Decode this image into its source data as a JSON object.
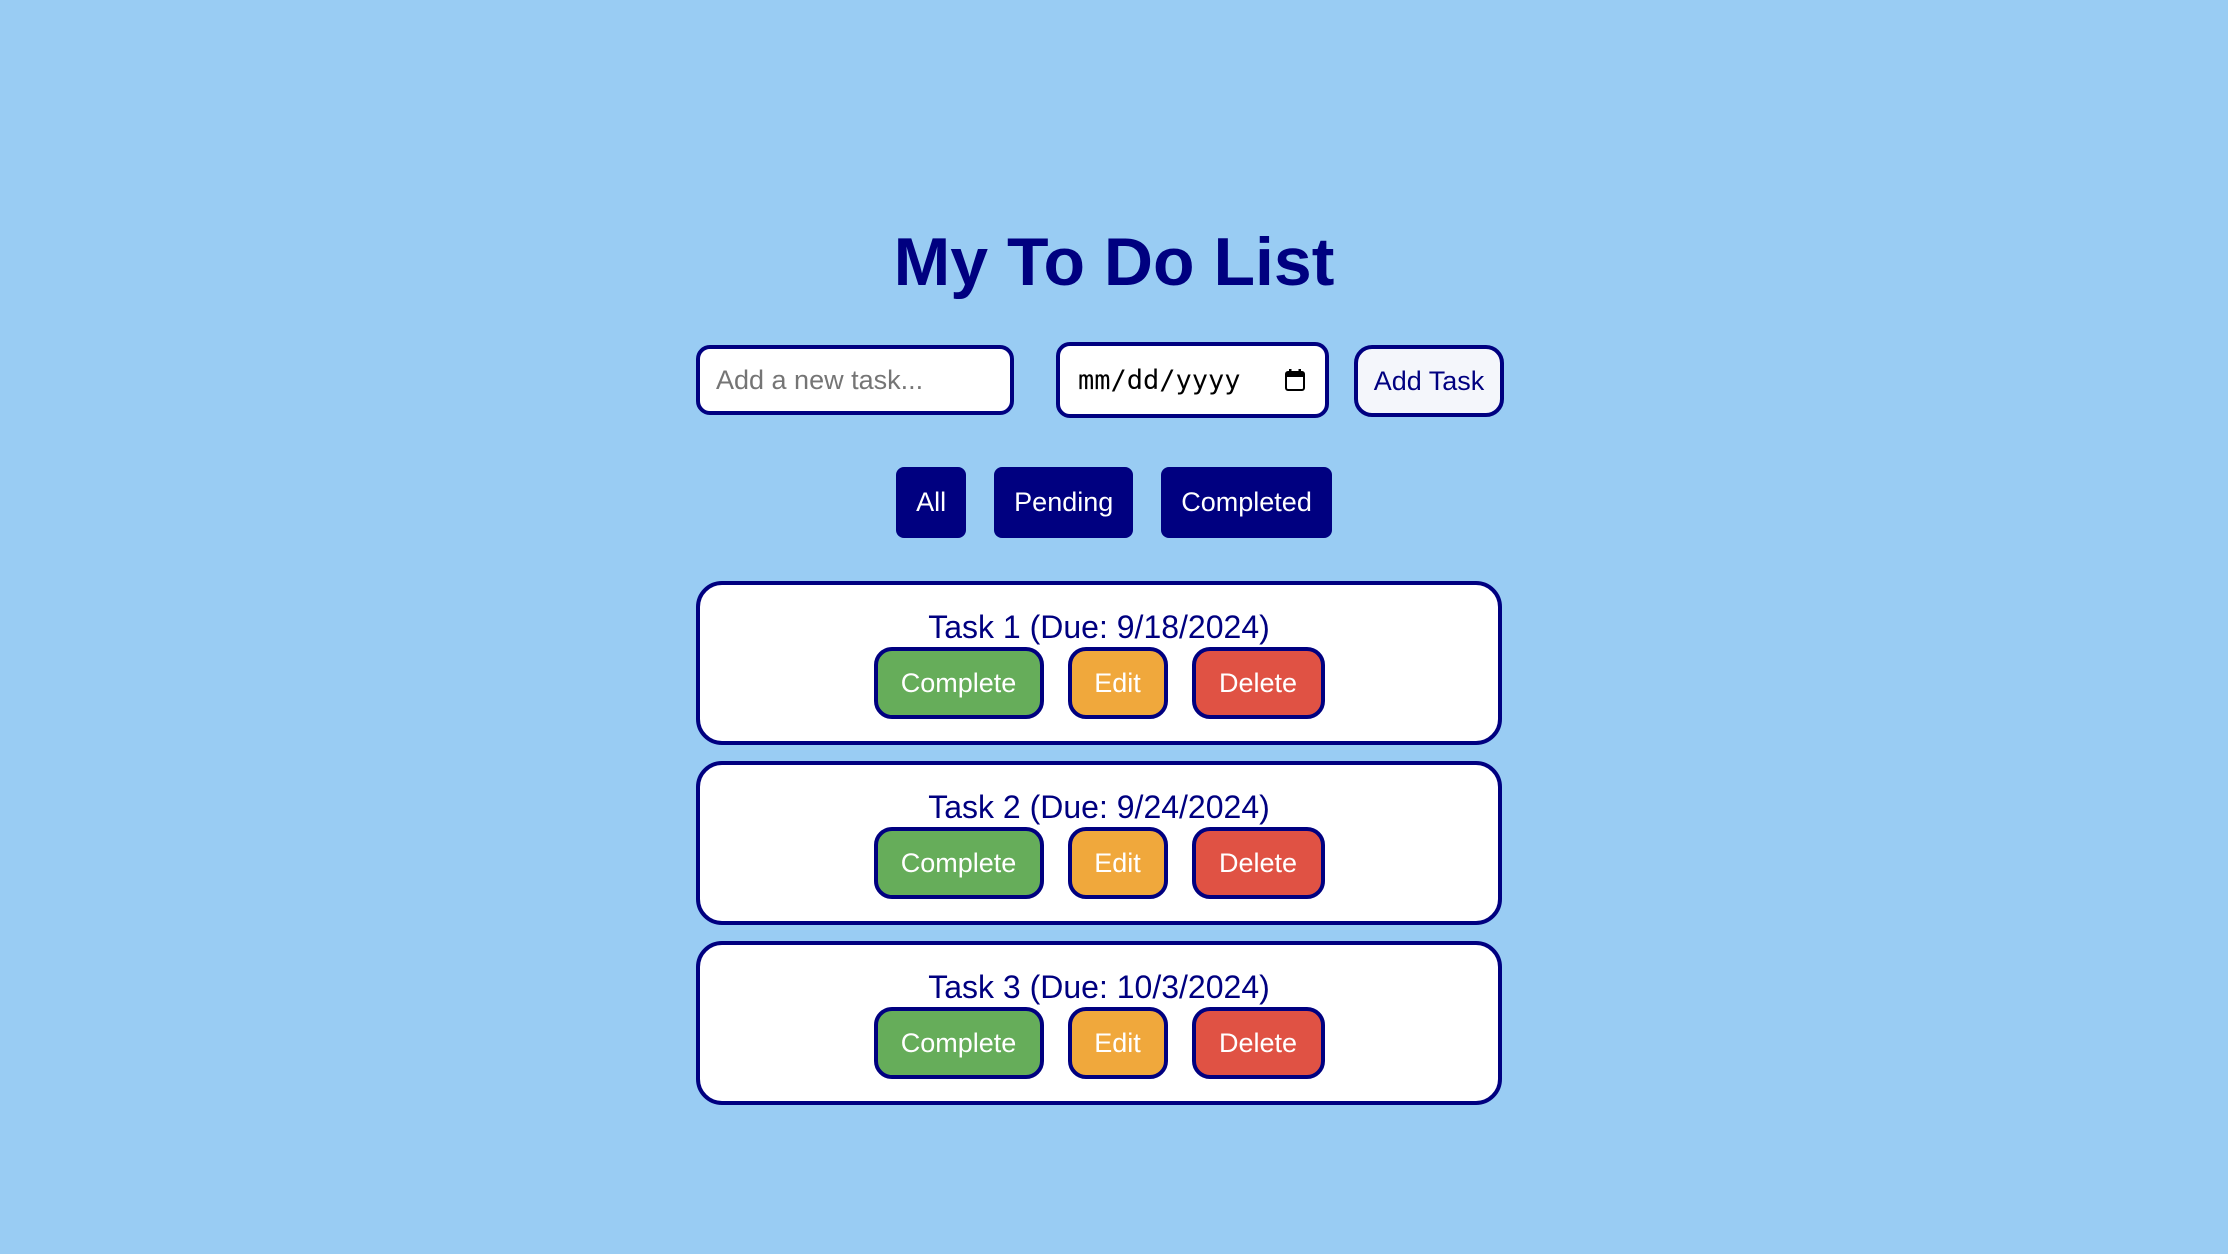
{
  "app": {
    "title": "My To Do List"
  },
  "add_form": {
    "task_placeholder": "Add a new task...",
    "task_value": "",
    "date_placeholder": "mm/dd/yyyy",
    "add_button_label": "Add Task"
  },
  "filters": [
    {
      "label": "All"
    },
    {
      "label": "Pending"
    },
    {
      "label": "Completed"
    }
  ],
  "tasks": [
    {
      "text": "Task 1 (Due: 9/18/2024)",
      "complete_label": "Complete",
      "edit_label": "Edit",
      "delete_label": "Delete"
    },
    {
      "text": "Task 2 (Due: 9/24/2024)",
      "complete_label": "Complete",
      "edit_label": "Edit",
      "delete_label": "Delete"
    },
    {
      "text": "Task 3 (Due: 10/3/2024)",
      "complete_label": "Complete",
      "edit_label": "Edit",
      "delete_label": "Delete"
    }
  ],
  "icons": {
    "date_picker": "calendar-icon"
  },
  "colors": {
    "background": "#99ccf3",
    "primary": "#000080",
    "complete": "#66ad5a",
    "edit": "#f0a83c",
    "delete": "#e05244"
  }
}
